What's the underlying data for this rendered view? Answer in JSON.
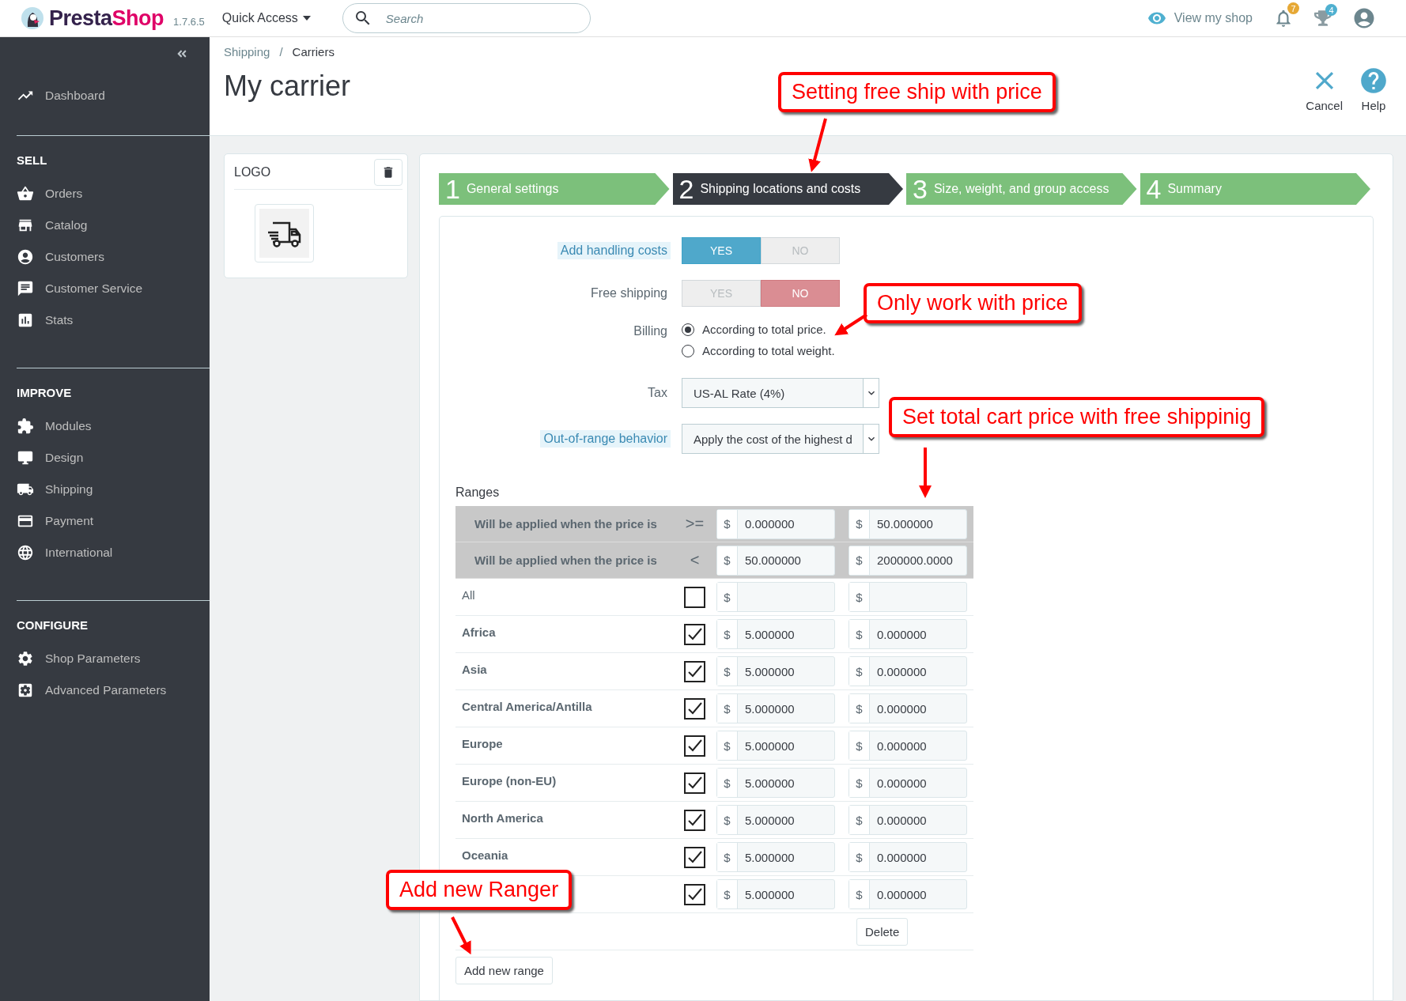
{
  "topbar": {
    "brand": [
      "Presta",
      "Shop"
    ],
    "version": "1.7.6.5",
    "quick_access": "Quick Access",
    "search": {
      "placeholder": "Search"
    },
    "view_shop": "View my shop",
    "notifications": "7",
    "trophies": "4"
  },
  "sidebar": {
    "sections": [
      {
        "items": [
          {
            "label": "Dashboard"
          }
        ]
      },
      {
        "title": "SELL",
        "items": [
          {
            "label": "Orders"
          },
          {
            "label": "Catalog"
          },
          {
            "label": "Customers"
          },
          {
            "label": "Customer Service"
          },
          {
            "label": "Stats"
          }
        ]
      },
      {
        "title": "IMPROVE",
        "items": [
          {
            "label": "Modules"
          },
          {
            "label": "Design"
          },
          {
            "label": "Shipping"
          },
          {
            "label": "Payment"
          },
          {
            "label": "International"
          }
        ]
      },
      {
        "title": "CONFIGURE",
        "items": [
          {
            "label": "Shop Parameters"
          },
          {
            "label": "Advanced Parameters"
          }
        ]
      }
    ]
  },
  "breadcrumb": {
    "items": [
      "Shipping",
      "Carriers"
    ],
    "separator": "/"
  },
  "title": "My carrier",
  "toolbar": [
    {
      "label": "Cancel"
    },
    {
      "label": "Help"
    }
  ],
  "logo_card": {
    "title": "LOGO"
  },
  "steps": [
    {
      "number": "1",
      "label": "General settings",
      "selected": false
    },
    {
      "number": "2",
      "label": "Shipping locations and costs",
      "selected": true
    },
    {
      "number": "3",
      "label": "Size, weight, and group access",
      "selected": false
    },
    {
      "number": "4",
      "label": "Summary",
      "selected": false
    }
  ],
  "form": {
    "handling": {
      "label": "Add handling costs",
      "help": true,
      "yes": "YES",
      "no": "NO",
      "on": true
    },
    "free_shipping": {
      "label": "Free shipping",
      "help": false,
      "yes": "YES",
      "no": "NO",
      "on": false
    },
    "billing": {
      "label": "Billing",
      "options": [
        {
          "label": "According to total price.",
          "selected": true
        },
        {
          "label": "According to total weight.",
          "selected": false
        }
      ]
    },
    "tax": {
      "label": "Tax",
      "help": false,
      "value": "US-AL Rate (4%)"
    },
    "out_of_range": {
      "label": "Out-of-range behavior",
      "help": true,
      "value": "Apply the cost of the highest d"
    }
  },
  "ranges": {
    "title": "Ranges",
    "bounds": [
      {
        "label": "Will be applied when the price is",
        "operator": ">=",
        "cells": [
          {
            "currency": "$",
            "value": "0.000000"
          },
          {
            "currency": "$",
            "value": "50.000000"
          }
        ]
      },
      {
        "label": "Will be applied when the price is",
        "operator": "<",
        "cells": [
          {
            "currency": "$",
            "value": "50.000000"
          },
          {
            "currency": "$",
            "value": "2000000.0000"
          }
        ]
      }
    ],
    "zones": [
      {
        "kind": "all",
        "name": "All",
        "checked": false,
        "cells": [
          {
            "currency": "$"
          },
          {
            "currency": "$"
          }
        ]
      },
      {
        "kind": "zone",
        "name": "Africa",
        "checked": true,
        "cells": [
          {
            "currency": "$",
            "value": "5.000000"
          },
          {
            "currency": "$",
            "value": "0.000000"
          }
        ]
      },
      {
        "kind": "zone",
        "name": "Asia",
        "checked": true,
        "cells": [
          {
            "currency": "$",
            "value": "5.000000"
          },
          {
            "currency": "$",
            "value": "0.000000"
          }
        ]
      },
      {
        "kind": "zone",
        "name": "Central America/Antilla",
        "checked": true,
        "cells": [
          {
            "currency": "$",
            "value": "5.000000"
          },
          {
            "currency": "$",
            "value": "0.000000"
          }
        ]
      },
      {
        "kind": "zone",
        "name": "Europe",
        "checked": true,
        "cells": [
          {
            "currency": "$",
            "value": "5.000000"
          },
          {
            "currency": "$",
            "value": "0.000000"
          }
        ]
      },
      {
        "kind": "zone",
        "name": "Europe (non-EU)",
        "checked": true,
        "cells": [
          {
            "currency": "$",
            "value": "5.000000"
          },
          {
            "currency": "$",
            "value": "0.000000"
          }
        ]
      },
      {
        "kind": "zone",
        "name": "North America",
        "checked": true,
        "cells": [
          {
            "currency": "$",
            "value": "5.000000"
          },
          {
            "currency": "$",
            "value": "0.000000"
          }
        ]
      },
      {
        "kind": "zone",
        "name": "Oceania",
        "checked": true,
        "cells": [
          {
            "currency": "$",
            "value": "5.000000"
          },
          {
            "currency": "$",
            "value": "0.000000"
          }
        ]
      },
      {
        "kind": "zone",
        "checked": true,
        "cells": [
          {
            "currency": "$",
            "value": "5.000000"
          },
          {
            "currency": "$",
            "value": "0.000000"
          }
        ]
      }
    ],
    "delete_button": "Delete",
    "add_button": "Add new range"
  },
  "annotations": [
    {
      "text": "Setting free ship with price"
    },
    {
      "text": "Only work with price"
    },
    {
      "text": "Set total cart price with free shippinig"
    },
    {
      "text": "Add new Ranger"
    }
  ]
}
